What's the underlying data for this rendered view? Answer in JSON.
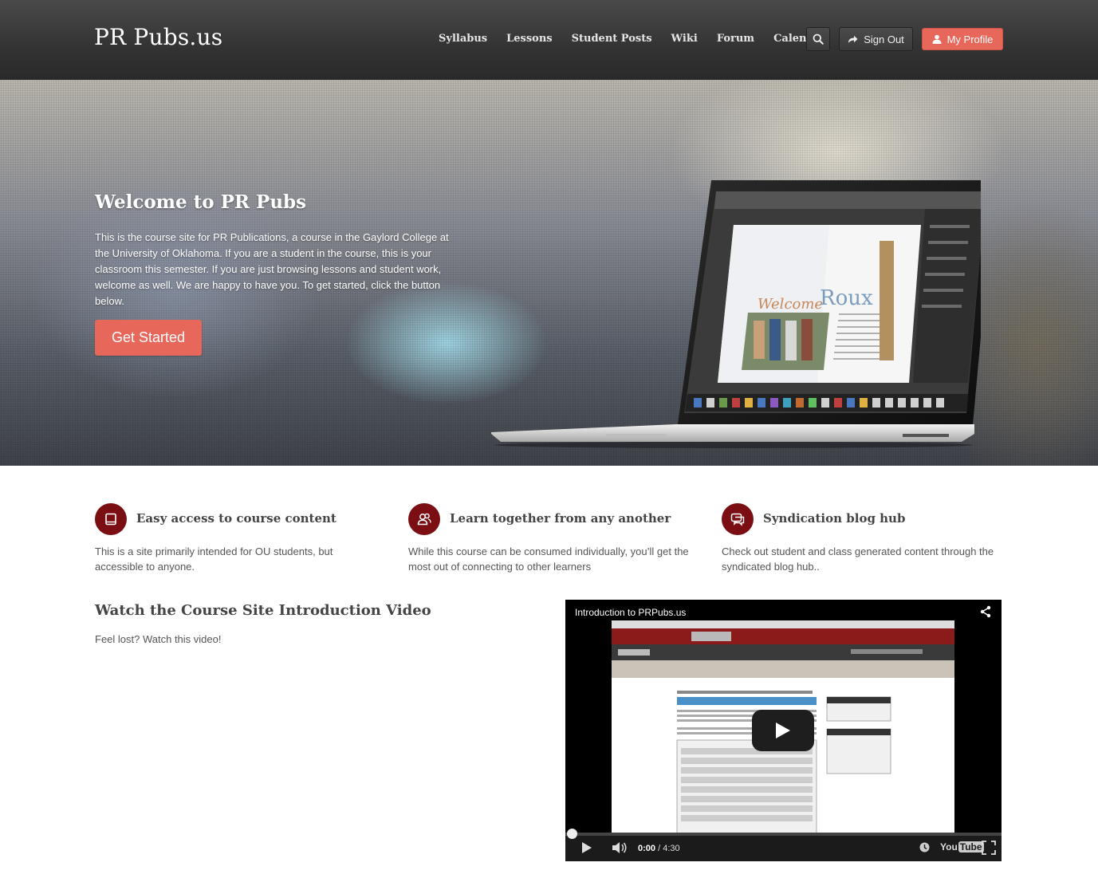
{
  "header": {
    "logo": "PR Pubs.us",
    "nav": [
      "Syllabus",
      "Lessons",
      "Student Posts",
      "Wiki",
      "Forum",
      "Calendar"
    ],
    "signout_label": "Sign Out",
    "profile_label": "My Profile",
    "accent_color": "#e8675b"
  },
  "hero": {
    "title": "Welcome to PR Pubs",
    "text": "This is the course site for PR Publications, a course in the Gaylord College at the University of Oklahoma. If you are a student in the course, this is your classroom this semester. If you are just browsing lessons and student work, welcome as well. We are happy to have you. To get started, click the button below.",
    "cta_label": "Get Started"
  },
  "features": [
    {
      "icon": "book-icon",
      "title": "Easy access to course content",
      "text": "This is a site primarily intended for OU students, but accessible to anyone."
    },
    {
      "icon": "users-icon",
      "title": "Learn together from any another",
      "text": "While this course can be consumed individually, you’ll get the most out of connecting to other learners"
    },
    {
      "icon": "chat-icon",
      "title": "Syndication blog hub",
      "text": "Check out student and class generated content through the syndicated blog hub.."
    }
  ],
  "video_section": {
    "heading": "Watch the Course Site Introduction Video",
    "subtext": "Feel lost? Watch this video!",
    "video_title": "Introduction to PRPubs.us",
    "time_current": "0:00",
    "time_total": "4:30",
    "progress_fraction": 0,
    "brand_badge_a": "You",
    "brand_badge_b": "Tube"
  },
  "colors": {
    "feature_icon_bg": "#7a0e12",
    "header_bg": "#3a3a3a"
  }
}
